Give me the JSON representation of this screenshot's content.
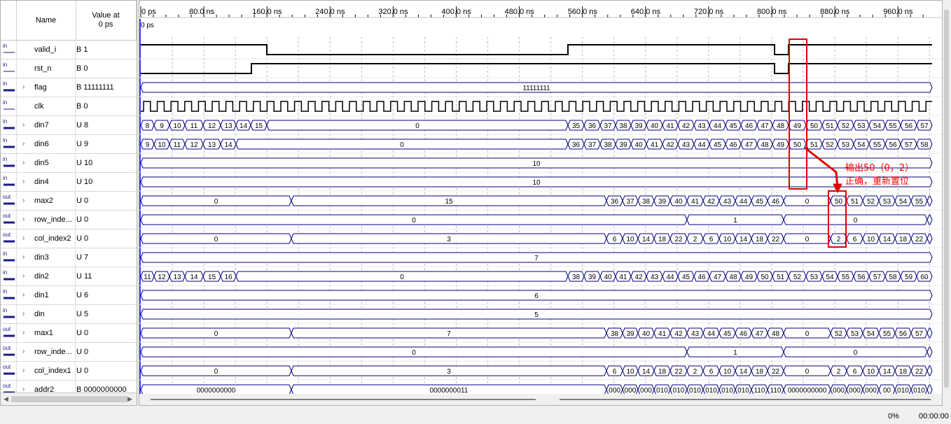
{
  "header": {
    "name_label": "Name",
    "value_label": "Value at\n0 ps"
  },
  "timeline": {
    "ticks": [
      "0 ps",
      "80.0 ns",
      "160.0 ns",
      "240.0 ns",
      "320.0 ns",
      "400.0 ns",
      "480.0 ns",
      "560.0 ns",
      "640.0 ns",
      "720.0 ns",
      "800.0 ns",
      "880.0 ns",
      "960.0 ns"
    ],
    "cursor_label": "0 ps"
  },
  "signals": [
    {
      "dir": "in",
      "bus": false,
      "name": "valid_i",
      "value": "B 1"
    },
    {
      "dir": "in",
      "bus": false,
      "name": "rst_n",
      "value": "B 0"
    },
    {
      "dir": "in",
      "bus": true,
      "name": "flag",
      "value": "B 11111111"
    },
    {
      "dir": "in",
      "bus": false,
      "name": "clk",
      "value": "B 0"
    },
    {
      "dir": "in",
      "bus": true,
      "name": "din7",
      "value": "U 8"
    },
    {
      "dir": "in",
      "bus": true,
      "name": "din6",
      "value": "U 9"
    },
    {
      "dir": "in",
      "bus": true,
      "name": "din5",
      "value": "U 10"
    },
    {
      "dir": "in",
      "bus": true,
      "name": "din4",
      "value": "U 10"
    },
    {
      "dir": "out",
      "bus": true,
      "name": "max2",
      "value": "U 0"
    },
    {
      "dir": "out",
      "bus": true,
      "name": "row_inde...",
      "value": "U 0"
    },
    {
      "dir": "out",
      "bus": true,
      "name": "col_index2",
      "value": "U 0"
    },
    {
      "dir": "in",
      "bus": true,
      "name": "din3",
      "value": "U 7"
    },
    {
      "dir": "in",
      "bus": true,
      "name": "din2",
      "value": "U 11"
    },
    {
      "dir": "in",
      "bus": true,
      "name": "din1",
      "value": "U 6"
    },
    {
      "dir": "in",
      "bus": true,
      "name": "din",
      "value": "U 5"
    },
    {
      "dir": "out",
      "bus": true,
      "name": "max1",
      "value": "U 0"
    },
    {
      "dir": "out",
      "bus": true,
      "name": "row_inde...",
      "value": "U 0"
    },
    {
      "dir": "out",
      "bus": true,
      "name": "col_index1",
      "value": "U 0"
    },
    {
      "dir": "out",
      "bus": true,
      "name": "addr2",
      "value": "B 0000000000"
    }
  ],
  "waves": {
    "valid_i": {
      "type": "bit",
      "edges": [
        [
          0,
          1
        ],
        [
          180,
          0
        ],
        [
          610,
          1
        ],
        [
          905,
          0
        ],
        [
          925,
          1
        ]
      ]
    },
    "rst_n": {
      "type": "bit",
      "edges": [
        [
          0,
          0
        ],
        [
          158,
          1
        ],
        [
          905,
          0
        ],
        [
          925,
          1
        ]
      ]
    },
    "flag": {
      "type": "bus",
      "segs": [
        [
          0,
          "11111111"
        ]
      ]
    },
    "clk": {
      "type": "clock",
      "period": 19.6,
      "start": 4
    },
    "din7": {
      "type": "bus",
      "segs": [
        [
          0,
          "8"
        ],
        [
          19,
          "9"
        ],
        [
          41,
          "10"
        ],
        [
          63,
          "11"
        ],
        [
          89,
          "12"
        ],
        [
          114,
          "13"
        ],
        [
          136,
          "14"
        ],
        [
          157,
          "15"
        ],
        [
          180,
          "0"
        ],
        [
          610,
          "35"
        ],
        [
          633,
          "36"
        ],
        [
          656,
          "37"
        ],
        [
          678,
          "38"
        ],
        [
          700,
          "39"
        ],
        [
          722,
          "40"
        ],
        [
          745,
          "41"
        ],
        [
          767,
          "42"
        ],
        [
          790,
          "43"
        ],
        [
          812,
          "44"
        ],
        [
          835,
          "45"
        ],
        [
          857,
          "46"
        ],
        [
          880,
          "47"
        ],
        [
          902,
          "48"
        ],
        [
          925,
          "49"
        ],
        [
          950,
          "50"
        ],
        [
          973,
          "51"
        ],
        [
          995,
          "52"
        ],
        [
          1018,
          "53"
        ],
        [
          1040,
          "54"
        ],
        [
          1063,
          "55"
        ],
        [
          1085,
          "56"
        ],
        [
          1108,
          "57"
        ]
      ]
    },
    "din6": {
      "type": "bus",
      "segs": [
        [
          0,
          "9"
        ],
        [
          19,
          "10"
        ],
        [
          41,
          "11"
        ],
        [
          63,
          "12"
        ],
        [
          89,
          "13"
        ],
        [
          114,
          "14"
        ],
        [
          136,
          "0"
        ],
        [
          610,
          "36"
        ],
        [
          633,
          "37"
        ],
        [
          656,
          "38"
        ],
        [
          678,
          "39"
        ],
        [
          700,
          "40"
        ],
        [
          722,
          "41"
        ],
        [
          745,
          "42"
        ],
        [
          767,
          "43"
        ],
        [
          790,
          "44"
        ],
        [
          812,
          "45"
        ],
        [
          835,
          "46"
        ],
        [
          857,
          "47"
        ],
        [
          880,
          "48"
        ],
        [
          902,
          "49"
        ],
        [
          925,
          "50"
        ],
        [
          950,
          "51"
        ],
        [
          973,
          "52"
        ],
        [
          995,
          "53"
        ],
        [
          1018,
          "54"
        ],
        [
          1040,
          "55"
        ],
        [
          1063,
          "56"
        ],
        [
          1085,
          "57"
        ],
        [
          1108,
          "58"
        ]
      ]
    },
    "din5": {
      "type": "bus",
      "segs": [
        [
          0,
          "10"
        ]
      ]
    },
    "din4": {
      "type": "bus",
      "segs": [
        [
          0,
          "10"
        ]
      ]
    },
    "max2": {
      "type": "bus",
      "segs": [
        [
          0,
          "0"
        ],
        [
          215,
          "15"
        ],
        [
          665,
          "36"
        ],
        [
          688,
          "37"
        ],
        [
          710,
          "38"
        ],
        [
          733,
          "39"
        ],
        [
          756,
          "40"
        ],
        [
          780,
          "41"
        ],
        [
          803,
          "42"
        ],
        [
          826,
          "43"
        ],
        [
          849,
          "44"
        ],
        [
          872,
          "45"
        ],
        [
          895,
          "46"
        ],
        [
          918,
          "0"
        ],
        [
          985,
          "50"
        ],
        [
          1008,
          "51"
        ],
        [
          1031,
          "52"
        ],
        [
          1054,
          "53"
        ],
        [
          1077,
          "54"
        ],
        [
          1100,
          "55"
        ],
        [
          1123,
          "5"
        ]
      ]
    },
    "row_index2": {
      "type": "bus",
      "segs": [
        [
          0,
          "0"
        ],
        [
          780,
          "1"
        ],
        [
          918,
          "0"
        ],
        [
          1123,
          "1"
        ]
      ]
    },
    "col_index2": {
      "type": "bus",
      "segs": [
        [
          0,
          "0"
        ],
        [
          215,
          "3"
        ],
        [
          665,
          "6"
        ],
        [
          688,
          "10"
        ],
        [
          710,
          "14"
        ],
        [
          733,
          "18"
        ],
        [
          756,
          "22"
        ],
        [
          780,
          "2"
        ],
        [
          803,
          "6"
        ],
        [
          826,
          "10"
        ],
        [
          849,
          "14"
        ],
        [
          872,
          "18"
        ],
        [
          895,
          "22"
        ],
        [
          918,
          "0"
        ],
        [
          985,
          "2"
        ],
        [
          1008,
          "6"
        ],
        [
          1031,
          "10"
        ],
        [
          1054,
          "14"
        ],
        [
          1077,
          "18"
        ],
        [
          1100,
          "22"
        ],
        [
          1123,
          "2"
        ]
      ]
    },
    "din3": {
      "type": "bus",
      "segs": [
        [
          0,
          "7"
        ]
      ]
    },
    "din2": {
      "type": "bus",
      "segs": [
        [
          0,
          "11"
        ],
        [
          19,
          "12"
        ],
        [
          41,
          "13"
        ],
        [
          63,
          "14"
        ],
        [
          89,
          "15"
        ],
        [
          114,
          "16"
        ],
        [
          136,
          "0"
        ],
        [
          610,
          "38"
        ],
        [
          633,
          "39"
        ],
        [
          656,
          "40"
        ],
        [
          678,
          "41"
        ],
        [
          700,
          "42"
        ],
        [
          722,
          "43"
        ],
        [
          745,
          "44"
        ],
        [
          767,
          "45"
        ],
        [
          790,
          "46"
        ],
        [
          812,
          "47"
        ],
        [
          835,
          "48"
        ],
        [
          857,
          "49"
        ],
        [
          880,
          "50"
        ],
        [
          902,
          "51"
        ],
        [
          925,
          "52"
        ],
        [
          950,
          "53"
        ],
        [
          973,
          "54"
        ],
        [
          995,
          "55"
        ],
        [
          1018,
          "56"
        ],
        [
          1040,
          "57"
        ],
        [
          1063,
          "58"
        ],
        [
          1085,
          "59"
        ],
        [
          1108,
          "60"
        ]
      ]
    },
    "din1": {
      "type": "bus",
      "segs": [
        [
          0,
          "6"
        ]
      ]
    },
    "din": {
      "type": "bus",
      "segs": [
        [
          0,
          "5"
        ]
      ]
    },
    "max1": {
      "type": "bus",
      "segs": [
        [
          0,
          "0"
        ],
        [
          215,
          "7"
        ],
        [
          665,
          "38"
        ],
        [
          688,
          "39"
        ],
        [
          710,
          "40"
        ],
        [
          733,
          "41"
        ],
        [
          756,
          "42"
        ],
        [
          780,
          "43"
        ],
        [
          803,
          "44"
        ],
        [
          826,
          "45"
        ],
        [
          849,
          "46"
        ],
        [
          872,
          "47"
        ],
        [
          895,
          "48"
        ],
        [
          918,
          "0"
        ],
        [
          985,
          "52"
        ],
        [
          1008,
          "53"
        ],
        [
          1031,
          "54"
        ],
        [
          1054,
          "55"
        ],
        [
          1077,
          "56"
        ],
        [
          1100,
          "57"
        ],
        [
          1123,
          "5"
        ]
      ]
    },
    "row_index1": {
      "type": "bus",
      "segs": [
        [
          0,
          "0"
        ],
        [
          780,
          "1"
        ],
        [
          918,
          "0"
        ],
        [
          1123,
          "1"
        ]
      ]
    },
    "col_index1": {
      "type": "bus",
      "segs": [
        [
          0,
          "0"
        ],
        [
          215,
          "3"
        ],
        [
          665,
          "6"
        ],
        [
          688,
          "10"
        ],
        [
          710,
          "14"
        ],
        [
          733,
          "18"
        ],
        [
          756,
          "22"
        ],
        [
          780,
          "2"
        ],
        [
          803,
          "6"
        ],
        [
          826,
          "10"
        ],
        [
          849,
          "14"
        ],
        [
          872,
          "18"
        ],
        [
          895,
          "22"
        ],
        [
          918,
          "0"
        ],
        [
          985,
          "2"
        ],
        [
          1008,
          "6"
        ],
        [
          1031,
          "10"
        ],
        [
          1054,
          "14"
        ],
        [
          1077,
          "18"
        ],
        [
          1100,
          "22"
        ],
        [
          1123,
          "2"
        ]
      ]
    },
    "addr2": {
      "type": "bus",
      "segs": [
        [
          0,
          "0000000000"
        ],
        [
          215,
          "0000000011"
        ],
        [
          665,
          "000"
        ],
        [
          688,
          "000"
        ],
        [
          710,
          "000"
        ],
        [
          733,
          "010"
        ],
        [
          756,
          "010"
        ],
        [
          780,
          "010"
        ],
        [
          803,
          "010"
        ],
        [
          826,
          "010"
        ],
        [
          849,
          "010"
        ],
        [
          872,
          "110"
        ],
        [
          895,
          "110"
        ],
        [
          918,
          "0000000000"
        ],
        [
          985,
          "000"
        ],
        [
          1008,
          "000"
        ],
        [
          1031,
          "000"
        ],
        [
          1054,
          "00"
        ],
        [
          1077,
          "010"
        ],
        [
          1100,
          "010"
        ],
        [
          1123,
          "0"
        ]
      ]
    }
  },
  "annotation": {
    "line1": "输出50（0，2）",
    "line2": "正确，重新置位",
    "color": "#ff0000"
  },
  "colors": {
    "bus_stroke": "#000080",
    "bit_stroke": "#000000",
    "grid": "#b8b8c8",
    "cursor": "#0000ff",
    "highlight": "#e00000"
  },
  "status": {
    "percent": "0%",
    "time": "00:00:00"
  }
}
